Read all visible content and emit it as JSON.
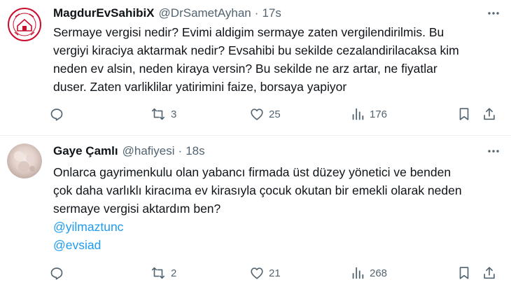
{
  "tweets": [
    {
      "name": "MagdurEvSahibiX",
      "handle": "@DrSametAyhan",
      "dot": "·",
      "time": "17s",
      "avatar_text": "EV SAHİPLERİ",
      "lines": [
        "Sermaye vergisi nedir? Evimi aldigim sermaye zaten vergilendirilmis. Bu",
        "vergiyi kiraciya aktarmak nedir? Evsahibi bu sekilde cezalandirilacaksa kim",
        "neden ev alsin, neden kiraya versin? Bu sekilde ne arz artar, ne fiyatlar",
        "duser. Zaten varliklilar yatirimini faize, borsaya yapiyor"
      ],
      "mentions": [],
      "actions": {
        "replies": "",
        "retweets": "3",
        "likes": "25",
        "views": "176"
      }
    },
    {
      "name": "Gaye Çamlı",
      "handle": "@hafiyesi",
      "dot": "·",
      "time": "18s",
      "lines": [
        "Onlarca gayrimenkulu olan yabancı firmada üst düzey yönetici ve benden",
        "çok daha varlıklı kiracıma ev kirasıyla çocuk okutan bir emekli olarak neden",
        "sermaye vergisi aktardım ben?"
      ],
      "mentions": [
        "@yilmaztunc",
        "@evsiad"
      ],
      "actions": {
        "replies": "",
        "retweets": "2",
        "likes": "21",
        "views": "268"
      }
    }
  ],
  "colors": {
    "text": "#0f1419",
    "muted": "#536471",
    "link": "#1d9bf0",
    "divider": "#eff3f4",
    "avatar_red": "#c8102e"
  },
  "icons": [
    "more-icon",
    "reply-icon",
    "retweet-icon",
    "like-icon",
    "views-icon",
    "bookmark-icon",
    "share-icon"
  ]
}
